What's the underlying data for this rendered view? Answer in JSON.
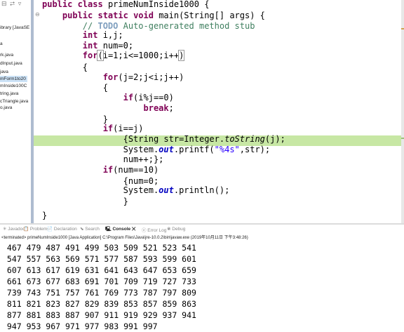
{
  "explorer": {
    "toolbar_icons": "⊟ ⮂ ▿",
    "items": [
      {
        "text": "ibrary [JavaSE",
        "decoration": "",
        "selected": false,
        "library": true
      },
      {
        "text": "a",
        "selected": false
      },
      {
        "text": "rk.java",
        "selected": false
      },
      {
        "text": "dInput.java",
        "selected": false
      },
      {
        "text": "java",
        "selected": false
      },
      {
        "text": "mForm1to20",
        "selected": true
      },
      {
        "text": "mInside100C",
        "selected": false
      },
      {
        "text": "tring.java",
        "selected": false
      },
      {
        "text": "cTriangle.java",
        "selected": false
      },
      {
        "text": "o.java",
        "selected": false
      }
    ]
  },
  "editor": {
    "ruler_markers": {
      "line3": "⊖",
      "line18": "▴"
    },
    "lines": [
      {
        "num": 1,
        "tokens": [
          [
            "kw",
            "public "
          ],
          [
            "kw",
            "class "
          ],
          [
            "",
            "primeNumInside1000 {"
          ]
        ]
      },
      {
        "num": 2,
        "tokens": [
          [
            "",
            "    "
          ],
          [
            "kw",
            "public "
          ],
          [
            "kw",
            "static "
          ],
          [
            "kw",
            "void "
          ],
          [
            "",
            "main(String[] args) {"
          ]
        ]
      },
      {
        "num": 3,
        "tokens": [
          [
            "",
            "        "
          ],
          [
            "cm",
            "// "
          ],
          [
            "tag",
            "TODO"
          ],
          [
            "cm",
            " Auto-generated method stub"
          ]
        ]
      },
      {
        "num": 4,
        "tokens": [
          [
            "",
            "        "
          ],
          [
            "kw",
            "int "
          ],
          [
            "",
            "i,j;"
          ]
        ]
      },
      {
        "num": 5,
        "tokens": [
          [
            "",
            "        "
          ],
          [
            "kw",
            "int "
          ],
          [
            "",
            "num=0;"
          ]
        ]
      },
      {
        "num": 6,
        "tokens": [
          [
            "",
            "        "
          ],
          [
            "kw",
            "for"
          ],
          [
            "bx",
            "("
          ],
          [
            "",
            "i=1;i<=1000;i++"
          ],
          [
            "bx",
            ")"
          ]
        ]
      },
      {
        "num": 7,
        "tokens": [
          [
            "",
            "        {"
          ]
        ]
      },
      {
        "num": 8,
        "tokens": [
          [
            "",
            "            "
          ],
          [
            "kw",
            "for"
          ],
          [
            "",
            "(j=2;j<i;j++)"
          ]
        ]
      },
      {
        "num": 9,
        "tokens": [
          [
            "",
            "            {"
          ]
        ]
      },
      {
        "num": 10,
        "tokens": [
          [
            "",
            "                "
          ],
          [
            "kw",
            "if"
          ],
          [
            "",
            "(i%j==0)"
          ]
        ]
      },
      {
        "num": 11,
        "tokens": [
          [
            "",
            "                    "
          ],
          [
            "kw",
            "break"
          ],
          [
            "",
            ";"
          ]
        ]
      },
      {
        "num": 12,
        "tokens": [
          [
            "",
            "            }"
          ]
        ]
      },
      {
        "num": 13,
        "tokens": [
          [
            "",
            "            "
          ],
          [
            "kw",
            "if"
          ],
          [
            "",
            "(i==j)"
          ]
        ]
      },
      {
        "num": 14,
        "tokens": [
          [
            "",
            "                {String str=Integer."
          ],
          [
            "smeth",
            "toString"
          ],
          [
            "",
            "(j);"
          ]
        ]
      },
      {
        "num": 15,
        "tokens": [
          [
            "",
            "                System."
          ],
          [
            "sfld",
            "out"
          ],
          [
            "",
            ".printf("
          ],
          [
            "st",
            "\"%4s\""
          ],
          [
            "",
            ",str);"
          ]
        ]
      },
      {
        "num": 16,
        "tokens": [
          [
            "",
            "                num++;};"
          ]
        ]
      },
      {
        "num": 17,
        "tokens": [
          [
            "",
            "            "
          ],
          [
            "kw",
            "if"
          ],
          [
            "",
            "(num==10)"
          ]
        ]
      },
      {
        "num": 18,
        "tokens": [
          [
            "",
            "                {num=0;"
          ]
        ]
      },
      {
        "num": 19,
        "tokens": [
          [
            "",
            "                System."
          ],
          [
            "sfld",
            "out"
          ],
          [
            "",
            ".println();"
          ]
        ]
      },
      {
        "num": 20,
        "tokens": [
          [
            "",
            "                }"
          ]
        ]
      },
      {
        "num": 21,
        "tokens": [
          [
            "",
            "    "
          ]
        ]
      },
      {
        "num": 22,
        "tokens": [
          [
            "",
            "}"
          ]
        ]
      }
    ]
  },
  "console_tabs": [
    {
      "label": "✳ Javadoc",
      "active": false
    },
    {
      "label": "📋 Problems",
      "active": false
    },
    {
      "label": "📄 Declaration",
      "active": false
    },
    {
      "label": "⬊ Search",
      "active": false
    },
    {
      "label": "🖳 Console ✕",
      "active": true
    },
    {
      "label": "ⓔ Error Log",
      "active": false
    },
    {
      "label": "❀ Debug",
      "active": false
    }
  ],
  "terminated": "<terminated> primeNumInside1000 [Java Application] C:\\Program Files\\Java\\jre-10.0.2\\bin\\javaw.exe (2019年10月11日 下午3:48:26)",
  "output_lines": [
    " 467 479 487 491 499 503 509 521 523 541",
    " 547 557 563 569 571 577 587 593 599 601",
    " 607 613 617 619 631 641 643 647 653 659",
    " 661 673 677 683 691 701 709 719 727 733",
    " 739 743 751 757 761 769 773 787 797 809",
    " 811 821 823 827 829 839 853 857 859 863",
    " 877 881 883 887 907 911 919 929 937 941",
    " 947 953 967 971 977 983 991 997"
  ]
}
